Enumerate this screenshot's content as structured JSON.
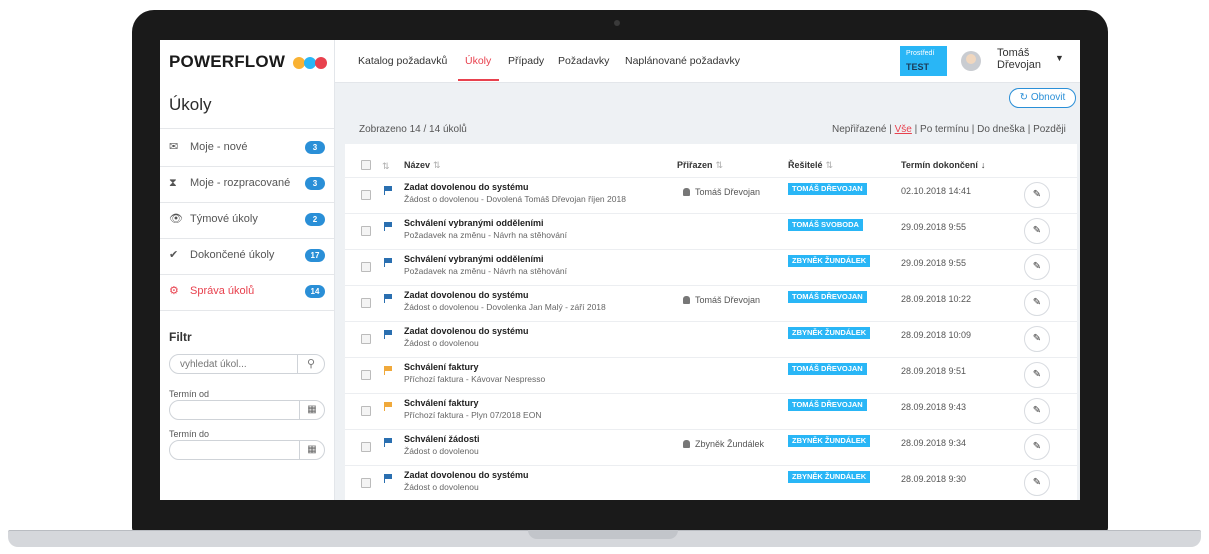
{
  "app": {
    "logo_text": "POWERFLOW",
    "logo_dot_colors": [
      "#f9b233",
      "#29b6f6",
      "#e8414e"
    ],
    "section_title": "Úkoly"
  },
  "sidebar": {
    "items": [
      {
        "label": "Moje - nové",
        "icon": "envelope-icon",
        "glyph": "✉",
        "badge": "3"
      },
      {
        "label": "Moje - rozpracované",
        "icon": "hourglass-icon",
        "glyph": "⧗",
        "badge": "3"
      },
      {
        "label": "Týmové úkoly",
        "icon": "eye-icon",
        "glyph": "👁",
        "badge": "2"
      },
      {
        "label": "Dokončené úkoly",
        "icon": "check-icon",
        "glyph": "✔",
        "badge": "17"
      },
      {
        "label": "Správa úkolů",
        "icon": "gears-icon",
        "glyph": "⚙",
        "badge": "14"
      }
    ],
    "filter": {
      "title": "Filtr",
      "search_placeholder": "vyhledat úkol...",
      "date_from_label": "Termín od",
      "date_to_label": "Termín do"
    }
  },
  "topnav": {
    "tabs": [
      "Katalog požadavků",
      "Úkoly",
      "Případy",
      "Požadavky",
      "Naplánované požadavky"
    ],
    "active_tab": "Úkoly",
    "environment_label": "Prostředí",
    "environment_value": "TEST",
    "user_first_name": "Tomáš",
    "user_last_name": "Dřevojan"
  },
  "toolbar": {
    "refresh_label": "Obnovit",
    "count_text": "Zobrazeno 14 / 14 úkolů",
    "filters": [
      "Nepřiřazené",
      "Vše",
      "Po termínu",
      "Do dneška",
      "Později"
    ],
    "active_filter": "Vše"
  },
  "table": {
    "headers": {
      "name": "Název",
      "assignee": "Přiřazen",
      "solvers": "Řešitelé",
      "deadline": "Termín dokončení"
    },
    "rows": [
      {
        "title": "Zadat dovolenou do systému",
        "subtitle": "Žádost o dovolenou - Dovolená Tomáš Dřevojan říjen 2018",
        "assignee": "Tomáš Dřevojan",
        "solver": "TOMÁŠ DŘEVOJAN",
        "date": "02.10.2018 14:41",
        "flag_color": "#2a6fb0"
      },
      {
        "title": "Schválení vybranými odděleními",
        "subtitle": "Požadavek na změnu - Návrh na stěhování",
        "assignee": "",
        "solver": "TOMÁŠ SVOBODA",
        "date": "29.09.2018 9:55",
        "flag_color": "#2a6fb0"
      },
      {
        "title": "Schválení vybranými odděleními",
        "subtitle": "Požadavek na změnu - Návrh na stěhování",
        "assignee": "",
        "solver": "ZBYNĚK ŽUNDÁLEK",
        "date": "29.09.2018 9:55",
        "flag_color": "#2a6fb0"
      },
      {
        "title": "Zadat dovolenou do systému",
        "subtitle": "Žádost o dovolenou - Dovolenka Jan Malý - září 2018",
        "assignee": "Tomáš Dřevojan",
        "solver": "TOMÁŠ DŘEVOJAN",
        "date": "28.09.2018 10:22",
        "flag_color": "#2a6fb0"
      },
      {
        "title": "Zadat dovolenou do systému",
        "subtitle": "Žádost o dovolenou",
        "assignee": "",
        "solver": "ZBYNĚK ŽUNDÁLEK",
        "date": "28.09.2018 10:09",
        "flag_color": "#2a6fb0"
      },
      {
        "title": "Schválení faktury",
        "subtitle": "Příchozí faktura - Kávovar Nespresso",
        "assignee": "",
        "solver": "TOMÁŠ DŘEVOJAN",
        "date": "28.09.2018 9:51",
        "flag_color": "#f0a93b"
      },
      {
        "title": "Schválení faktury",
        "subtitle": "Příchozí faktura - Plyn 07/2018 EON",
        "assignee": "",
        "solver": "TOMÁŠ DŘEVOJAN",
        "date": "28.09.2018 9:43",
        "flag_color": "#f0a93b"
      },
      {
        "title": "Schválení žádosti",
        "subtitle": "Žádost o dovolenou",
        "assignee": "Zbyněk Žundálek",
        "solver": "ZBYNĚK ŽUNDÁLEK",
        "date": "28.09.2018 9:34",
        "flag_color": "#2a6fb0"
      },
      {
        "title": "Zadat dovolenou do systému",
        "subtitle": "Žádost o dovolenou",
        "assignee": "",
        "solver": "ZBYNĚK ŽUNDÁLEK",
        "date": "28.09.2018 9:30",
        "flag_color": "#2a6fb0"
      }
    ]
  },
  "colors": {
    "accent": "#e8414e",
    "primary": "#2a8fd7",
    "tag": "#29b6f6"
  }
}
